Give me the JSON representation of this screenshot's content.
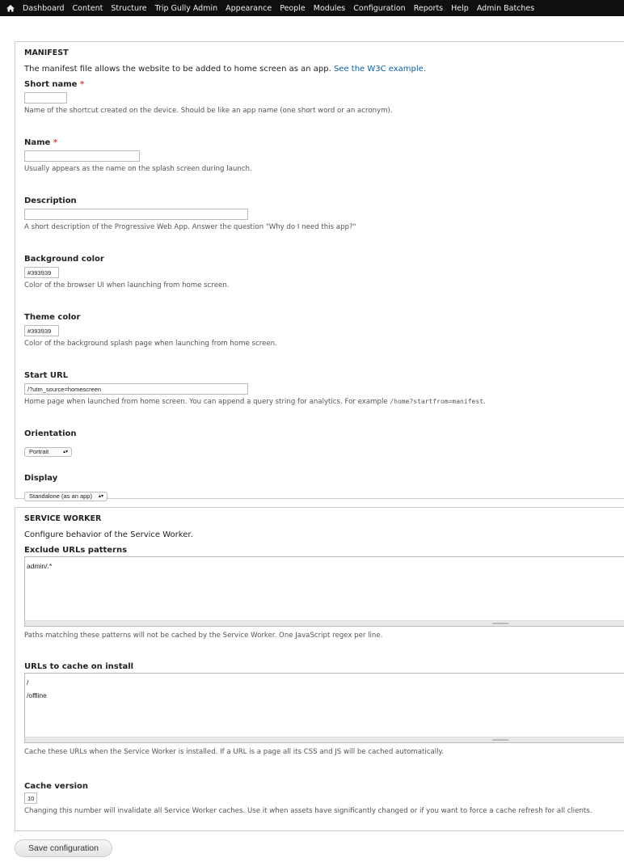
{
  "toolbar": {
    "items": [
      "Dashboard",
      "Content",
      "Structure",
      "Trip Gully Admin",
      "Appearance",
      "People",
      "Modules",
      "Configuration",
      "Reports",
      "Help",
      "Admin Batches"
    ]
  },
  "manifest": {
    "legend": "MANIFEST",
    "intro": "The manifest file allows the website to be added to home screen as an app.",
    "intro_link": "See the W3C example.",
    "short_name": {
      "label": "Short name",
      "required": "*",
      "value": "",
      "desc": "Name of the shortcut created on the device. Should be like an app name (one short word or an acronym)."
    },
    "name": {
      "label": "Name",
      "required": "*",
      "value": "",
      "desc": "Usually appears as the name on the splash screen during launch."
    },
    "description": {
      "label": "Description",
      "value": "",
      "desc": "A short description of the Progressive Web App. Answer the question \"Why do I need this app?\""
    },
    "background_color": {
      "label": "Background color",
      "value": "#393939",
      "desc": "Color of the browser UI when launching from home screen."
    },
    "theme_color": {
      "label": "Theme color",
      "value": "#393939",
      "desc": "Color of the background splash page when launching from home screen."
    },
    "start_url": {
      "label": "Start URL",
      "value": "/?utm_source=homescreen",
      "desc": "Home page when launched from home screen. You can append a query string for analytics. For example",
      "desc_code": "/home?startfrom=manifest",
      "desc_end": "."
    },
    "orientation": {
      "label": "Orientation",
      "value": "Portrait"
    },
    "display": {
      "label": "Display",
      "value": "Standalone (as an app)"
    }
  },
  "service_worker": {
    "legend": "SERVICE WORKER",
    "intro": "Configure behavior of the Service Worker.",
    "exclude": {
      "label": "Exclude URLs patterns",
      "value": "admin/.*",
      "desc": "Paths matching these patterns will not be cached by the Service Worker. One JavaScript regex per line."
    },
    "urls": {
      "label": "URLs to cache on install",
      "value": "/\n/offline",
      "desc": "Cache these URLs when the Service Worker is installed. If a URL is a page all its CSS and JS will be cached automatically."
    },
    "cache_version": {
      "label": "Cache version",
      "value": "10",
      "desc": "Changing this number will invalidate all Service Worker caches. Use it when assets have significantly changed or if you want to force a cache refresh for all clients."
    }
  },
  "save_label": "Save configuration"
}
